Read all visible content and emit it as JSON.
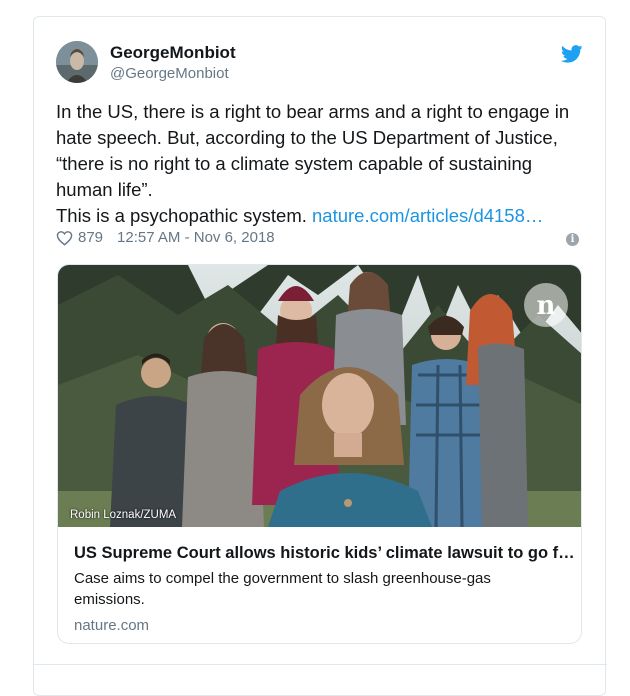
{
  "tweet": {
    "display_name": "GeorgeMonbiot",
    "handle": "@GeorgeMonbiot",
    "text_lines": [
      "In the US, there is a right to bear arms and a right to engage in",
      "hate speech. But, according to the US Department of Justice,",
      "“there is no right to a climate system capable of sustaining",
      "human life”."
    ],
    "last_line_text": "This is a psychopathic system. ",
    "link_text": "nature.com/articles/d4158…",
    "likes": "879",
    "timestamp": "12:57 AM - Nov 6, 2018",
    "info_glyph": "i"
  },
  "card": {
    "photo_credit": "Robin Loznak/ZUMA",
    "logo_letter": "n",
    "title": "US Supreme Court allows historic kids’ climate lawsuit to go f…",
    "description": "Case aims to compel the government to slash greenhouse-gas emissions.",
    "domain": "nature.com"
  },
  "colors": {
    "twitter_blue": "#1da1f2",
    "link": "#1b95e0",
    "muted": "#657786",
    "border": "#e1e8ed"
  },
  "icons": {
    "brand": "twitter-bird-icon",
    "like": "heart-icon",
    "info": "info-icon",
    "publisher": "nature-logo-icon"
  }
}
